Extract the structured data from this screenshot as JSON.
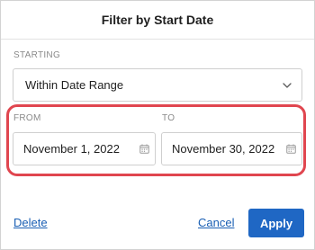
{
  "dialog": {
    "title": "Filter by Start Date"
  },
  "starting": {
    "label": "STARTING",
    "selected": "Within Date Range",
    "dropdown_icon": "chevron-down-icon"
  },
  "range": {
    "from_label": "FROM",
    "from_value": "November 1, 2022",
    "to_label": "TO",
    "to_value": "November 30, 2022",
    "field_icon": "calendar-icon",
    "highlight_color": "#e0464f"
  },
  "footer": {
    "delete_label": "Delete",
    "cancel_label": "Cancel",
    "apply_label": "Apply"
  },
  "colors": {
    "link": "#1a5fb4",
    "primary_button": "#1f67c4"
  }
}
